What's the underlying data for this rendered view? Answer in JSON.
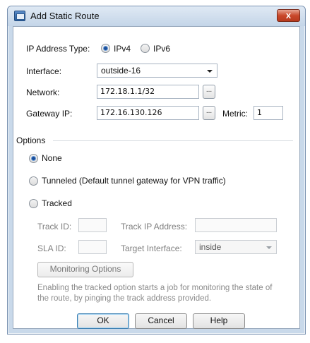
{
  "window": {
    "title": "Add Static Route",
    "close_label": "x"
  },
  "form": {
    "ip_type_label": "IP Address Type:",
    "ipv4_label": "IPv4",
    "ipv6_label": "IPv6",
    "selected_ip_type": "IPv4",
    "interface_label": "Interface:",
    "interface_value": "outside-16",
    "network_label": "Network:",
    "network_value": "172.18.1.1/32",
    "gateway_label": "Gateway IP:",
    "gateway_value": "172.16.130.126",
    "metric_label": "Metric:",
    "metric_value": "1",
    "browse_label": "..."
  },
  "options": {
    "group_label": "Options",
    "none_label": "None",
    "tunneled_label": "Tunneled (Default tunnel gateway for VPN traffic)",
    "tracked_label": "Tracked",
    "selected": "None",
    "track_id_label": "Track ID:",
    "track_id_value": "",
    "track_ip_label": "Track IP Address:",
    "track_ip_value": "",
    "sla_id_label": "SLA ID:",
    "sla_id_value": "",
    "target_interface_label": "Target Interface:",
    "target_interface_value": "inside",
    "monitoring_button": "Monitoring Options",
    "note": "Enabling the tracked option starts a job for monitoring the state of the route, by pinging the track address provided."
  },
  "buttons": {
    "ok": "OK",
    "cancel": "Cancel",
    "help": "Help"
  }
}
